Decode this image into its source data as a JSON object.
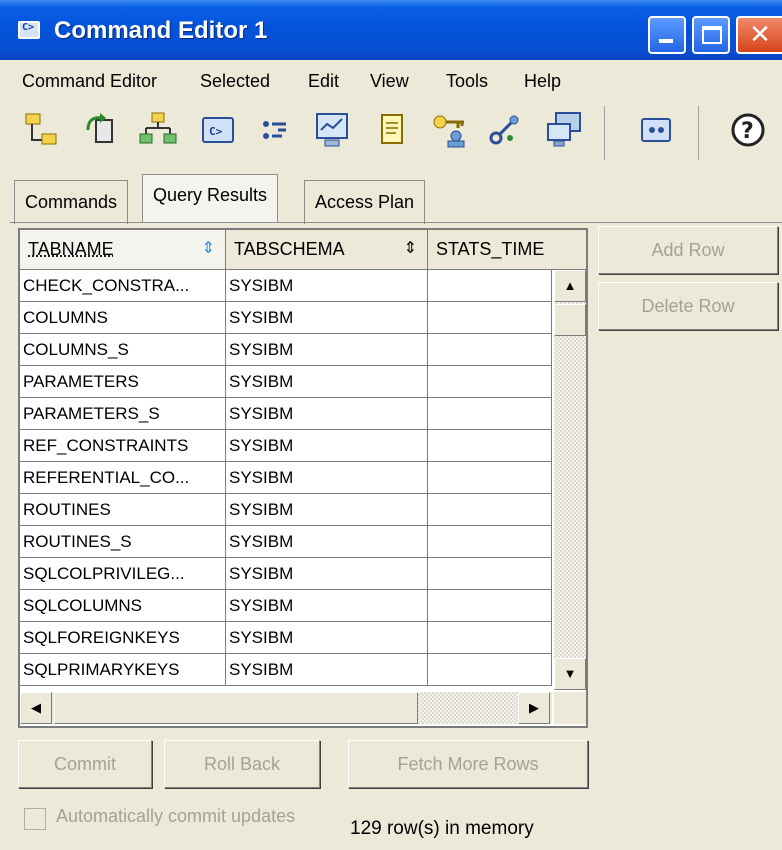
{
  "window": {
    "title": "Command Editor 1"
  },
  "menu": [
    "Command Editor",
    "Selected",
    "Edit",
    "View",
    "Tools",
    "Help"
  ],
  "toolbar": {
    "icons": [
      "tree-icon",
      "connect-icon",
      "hierarchy-icon",
      "command-window-icon",
      "options-icon",
      "monitor-icon",
      "notepad-icon",
      "key-user-icon",
      "tools-icon",
      "computer-icon",
      "terminal-icon",
      "help-icon"
    ]
  },
  "tabs": [
    "Commands",
    "Query Results",
    "Access Plan"
  ],
  "table": {
    "columns": [
      "TABNAME",
      "TABSCHEMA",
      "STATS_TIME"
    ],
    "rows": [
      [
        "CHECK_CONSTRA...",
        "SYSIBM",
        ""
      ],
      [
        "COLUMNS",
        "SYSIBM",
        ""
      ],
      [
        "COLUMNS_S",
        "SYSIBM",
        ""
      ],
      [
        "PARAMETERS",
        "SYSIBM",
        ""
      ],
      [
        "PARAMETERS_S",
        "SYSIBM",
        ""
      ],
      [
        "REF_CONSTRAINTS",
        "SYSIBM",
        ""
      ],
      [
        "REFERENTIAL_CO...",
        "SYSIBM",
        ""
      ],
      [
        "ROUTINES",
        "SYSIBM",
        ""
      ],
      [
        "ROUTINES_S",
        "SYSIBM",
        ""
      ],
      [
        "SQLCOLPRIVILEG...",
        "SYSIBM",
        ""
      ],
      [
        "SQLCOLUMNS",
        "SYSIBM",
        ""
      ],
      [
        "SQLFOREIGNKEYS",
        "SYSIBM",
        ""
      ],
      [
        "SQLPRIMARYKEYS",
        "SYSIBM",
        ""
      ]
    ]
  },
  "side_buttons": {
    "add_row": "Add Row",
    "delete_row": "Delete Row"
  },
  "bottom_buttons": {
    "commit": "Commit",
    "roll_back": "Roll Back",
    "fetch_more": "Fetch More Rows"
  },
  "auto_commit": {
    "label": "Automatically commit updates",
    "checked": false
  },
  "status": "129 row(s) in memory"
}
